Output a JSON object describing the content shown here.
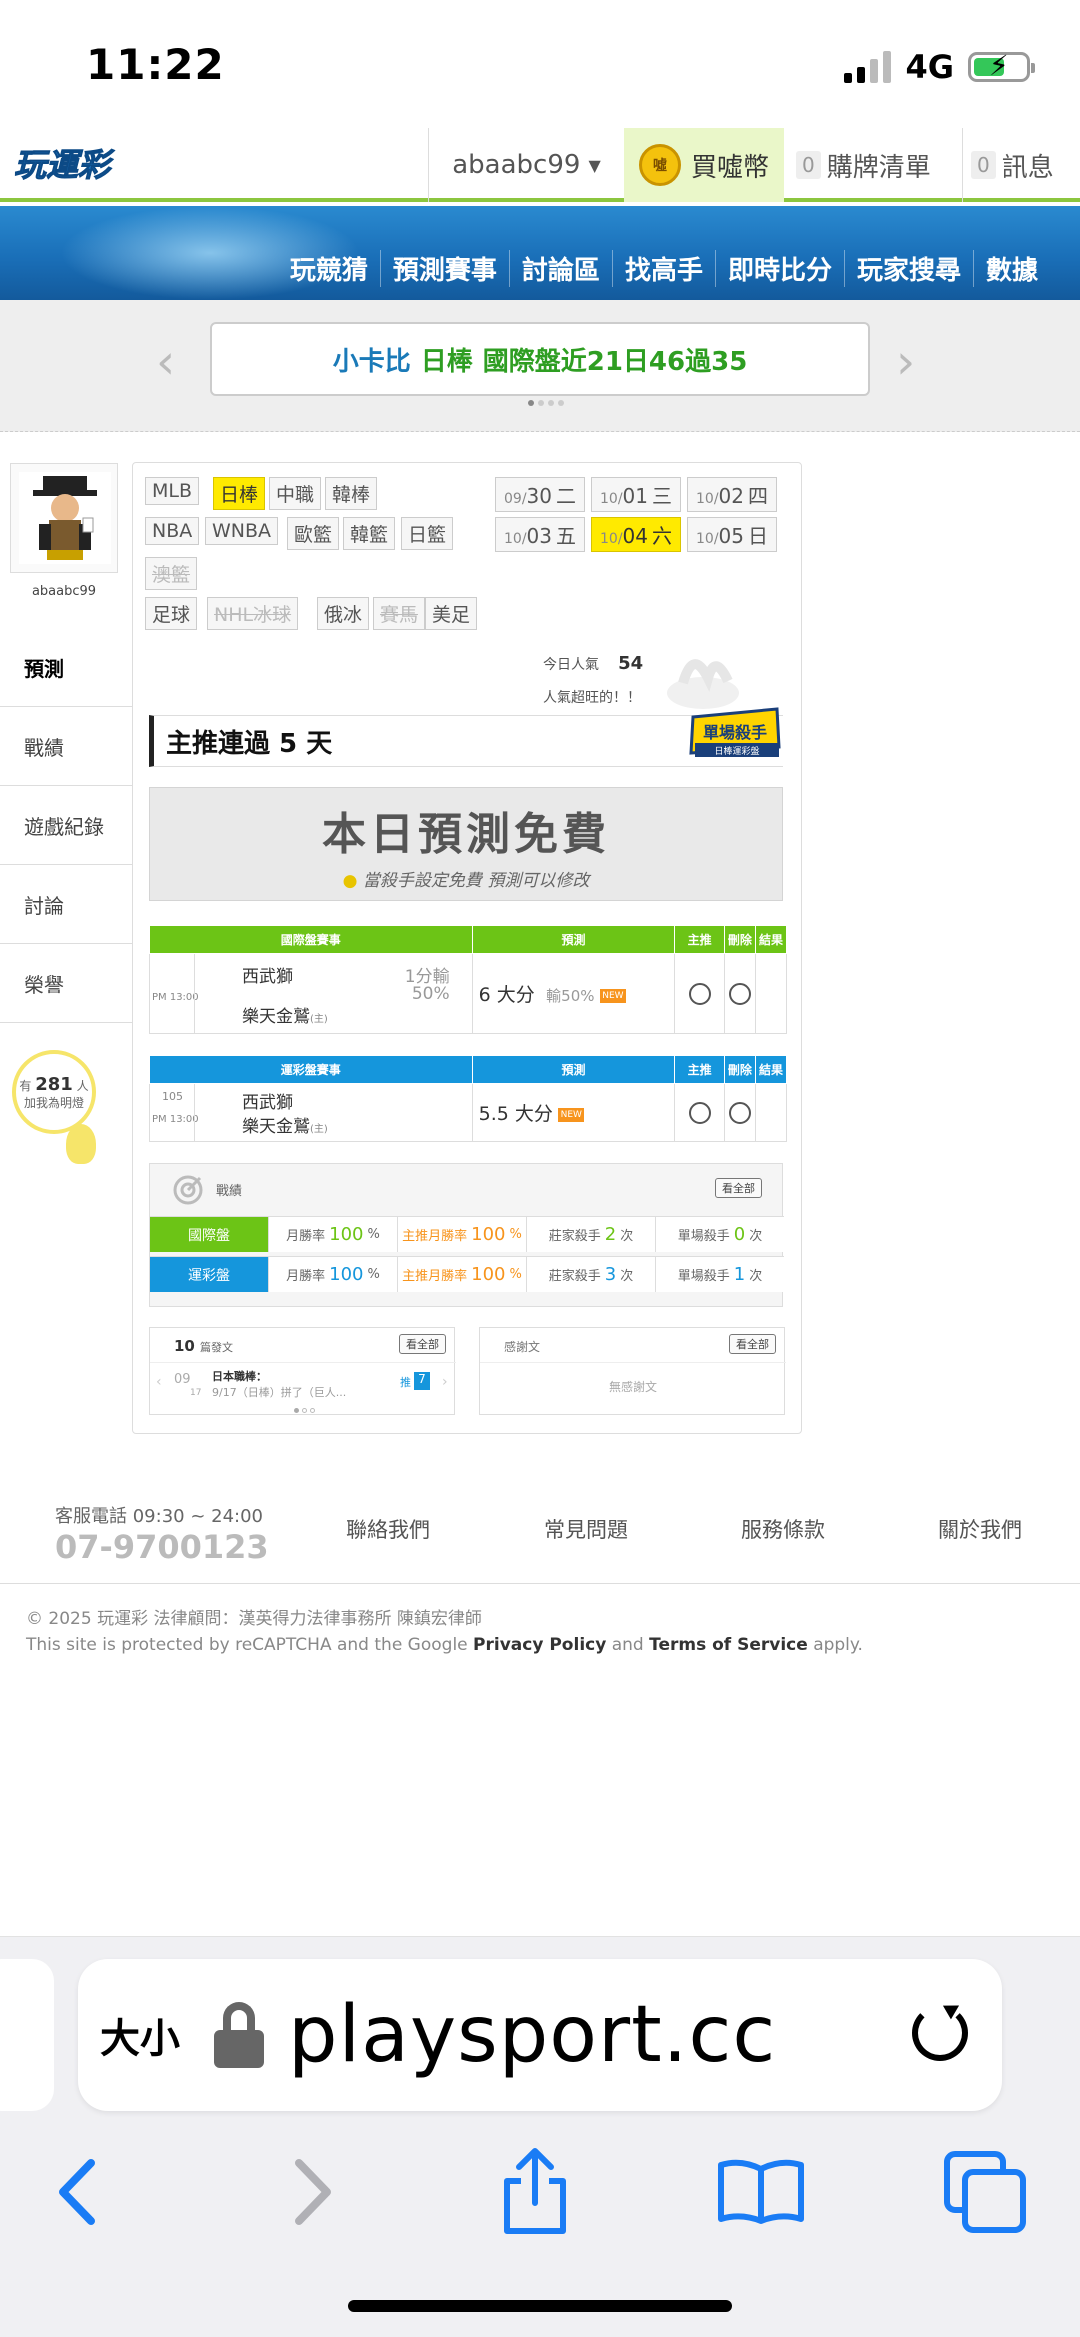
{
  "status": {
    "time": "11:22",
    "network": "4G"
  },
  "topbar": {
    "username": "abaabc99",
    "buy_coin": "買噓幣",
    "coin_label": "噓",
    "cart_count": "0",
    "cart_label": "購牌清單",
    "msg_count": "0",
    "msg_label": "訊息"
  },
  "menu": [
    "玩競猜",
    "預測賽事",
    "討論區",
    "找高手",
    "即時比分",
    "玩家搜尋",
    "數據"
  ],
  "banner": {
    "prefix": "小卡比",
    "highlight": "日棒",
    "suffix": "國際盤近21日46過35"
  },
  "profile": {
    "name": "abaabc99"
  },
  "sidenav": [
    "預測",
    "戰績",
    "遊戲紀錄",
    "討論",
    "榮譽"
  ],
  "fans": {
    "pre": "有",
    "count": "281",
    "unit": "人",
    "label": "加我為明燈"
  },
  "categories": {
    "row1": [
      "MLB",
      "日棒",
      "中職",
      "韓棒"
    ],
    "row2": [
      "NBA",
      "WNBA",
      "歐籃",
      "韓籃",
      "日籃"
    ],
    "row3": [
      "澳籃"
    ],
    "row4": [
      "足球",
      "NHL冰球",
      "俄冰",
      "賽馬",
      "美足"
    ],
    "active": "日棒"
  },
  "dates": [
    {
      "md": "09/",
      "d": "30",
      "w": "二"
    },
    {
      "md": "10/",
      "d": "01",
      "w": "三"
    },
    {
      "md": "10/",
      "d": "02",
      "w": "四"
    },
    {
      "md": "10/",
      "d": "03",
      "w": "五"
    },
    {
      "md": "10/",
      "d": "04",
      "w": "六"
    },
    {
      "md": "10/",
      "d": "05",
      "w": "日"
    }
  ],
  "popularity": {
    "label": "今日人氣",
    "value": "54",
    "note": "人氣超旺的！！"
  },
  "streak_title": "主推連過 5 天",
  "killer_badge": {
    "title": "單場殺手",
    "sub": "日棒運彩盤"
  },
  "free_banner": {
    "title": "本日預測免費",
    "sub": "當殺手設定免費  預測可以修改"
  },
  "intl_table": {
    "headers": [
      "國際盤賽事",
      "預測",
      "主推",
      "刪除",
      "結果"
    ],
    "row": {
      "time": "PM 13:00",
      "team_away": "西武獅",
      "team_home": "樂天金鷲",
      "home_mark": "(主)",
      "line1": "1分輸",
      "line2": "50%",
      "pick": "6 大分",
      "pick_note": "輸50%",
      "new_tag": "NEW"
    }
  },
  "lottery_table": {
    "headers": [
      "運彩盤賽事",
      "預測",
      "主推",
      "刪除",
      "結果"
    ],
    "row": {
      "num": "105",
      "time": "PM 13:00",
      "team_away": "西武獅",
      "team_home": "樂天金鷲",
      "home_mark": "(主)",
      "pick": "5.5 大分",
      "new_tag": "NEW"
    }
  },
  "record": {
    "title": "戰績",
    "view_all": "看全部",
    "rows": [
      {
        "label": "國際盤",
        "month_label": "月勝率",
        "month": "100",
        "main_label": "主推月勝率",
        "main": "100",
        "pct": "%",
        "banker_label": "莊家殺手",
        "banker": "2",
        "single_label": "單場殺手",
        "single": "0",
        "times": "次"
      },
      {
        "label": "運彩盤",
        "month_label": "月勝率",
        "month": "100",
        "main_label": "主推月勝率",
        "main": "100",
        "pct": "%",
        "banker_label": "莊家殺手",
        "banker": "3",
        "single_label": "單場殺手",
        "single": "1",
        "times": "次"
      }
    ],
    "colors": {
      "intl": "#6cc416",
      "lottery": "#1596dc",
      "main": "#f7941d"
    }
  },
  "posts": {
    "count": "10",
    "label": "篇發文",
    "view_all": "看全部",
    "month": "09",
    "day": "17",
    "title": "日本職棒：",
    "snippet": "9/17（日棒）拼了（巨人...",
    "push_label": "推",
    "push_count": "7"
  },
  "thanks": {
    "label": "感謝文",
    "view_all": "看全部",
    "empty": "無感謝文"
  },
  "footer": {
    "hotline_label": "客服電話 09:30 ~ 24:00",
    "hotline": "07-9700123",
    "links": [
      "聯絡我們",
      "常見問題",
      "服務條款",
      "關於我們"
    ],
    "copyright": "© 2025 玩運彩 法律顧問：漢英得力法律事務所 陳鎮宏律師",
    "recaptcha_pre": "This site is protected by reCAPTCHA and the Google",
    "privacy": "Privacy Policy",
    "and": "and",
    "terms": "Terms of Service",
    "apply": "apply."
  },
  "browser": {
    "aa": "大小",
    "url": "playsport.cc"
  }
}
